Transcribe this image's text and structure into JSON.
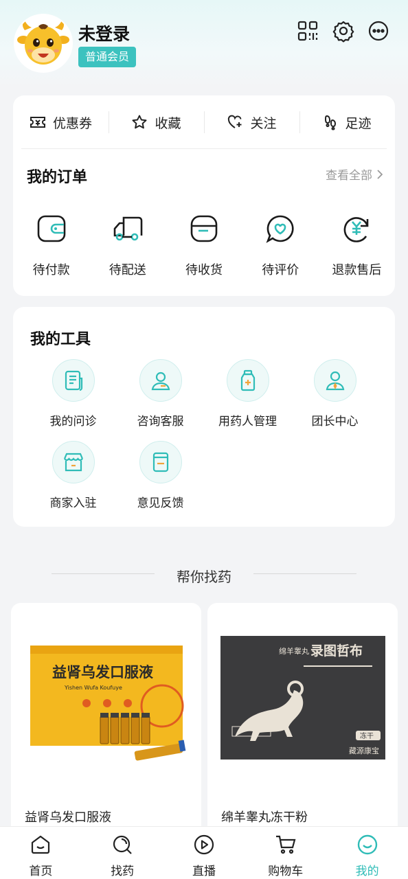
{
  "profile": {
    "username": "未登录",
    "member_level": "普通会员"
  },
  "header_icons": [
    "qr-code-icon",
    "settings-icon",
    "more-icon"
  ],
  "quick_links": [
    {
      "label": "优惠券",
      "icon": "ticket-icon"
    },
    {
      "label": "收藏",
      "icon": "star-icon"
    },
    {
      "label": "关注",
      "icon": "heart-plus-icon"
    },
    {
      "label": "足迹",
      "icon": "footprint-icon"
    }
  ],
  "orders": {
    "title": "我的订单",
    "view_all": "查看全部",
    "items": [
      {
        "label": "待付款",
        "icon": "wallet-icon"
      },
      {
        "label": "待配送",
        "icon": "truck-icon"
      },
      {
        "label": "待收货",
        "icon": "package-icon"
      },
      {
        "label": "待评价",
        "icon": "review-icon"
      },
      {
        "label": "退款售后",
        "icon": "refund-icon"
      }
    ]
  },
  "tools": {
    "title": "我的工具",
    "items": [
      {
        "label": "我的问诊",
        "icon": "consultation-icon"
      },
      {
        "label": "咨询客服",
        "icon": "customer-service-icon"
      },
      {
        "label": "用药人管理",
        "icon": "medicine-bottle-icon"
      },
      {
        "label": "团长中心",
        "icon": "leader-icon"
      },
      {
        "label": "商家入驻",
        "icon": "store-icon"
      },
      {
        "label": "意见反馈",
        "icon": "feedback-icon"
      }
    ]
  },
  "find_medicine": {
    "title": "帮你找药",
    "products": [
      {
        "name": "益肾乌发口服液",
        "box_title": "益肾乌发口服液",
        "box_subtitle": "Yishen Wufa Koufuye"
      },
      {
        "name": "绵羊睾丸冻干粉",
        "box_title": "录图哲布",
        "box_prefix": "绵羊睾丸",
        "box_brand": "藏源康宝",
        "box_tag": "冻干"
      }
    ]
  },
  "tabbar": [
    {
      "label": "首页",
      "icon": "home-icon",
      "active": false
    },
    {
      "label": "找药",
      "icon": "search-icon",
      "active": false
    },
    {
      "label": "直播",
      "icon": "play-icon",
      "active": false
    },
    {
      "label": "购物车",
      "icon": "cart-icon",
      "active": false
    },
    {
      "label": "我的",
      "icon": "profile-smile-icon",
      "active": true
    }
  ],
  "colors": {
    "accent": "#3cc2bf",
    "active_tab": "#2fbcb7",
    "background": "#f3f4f6"
  }
}
